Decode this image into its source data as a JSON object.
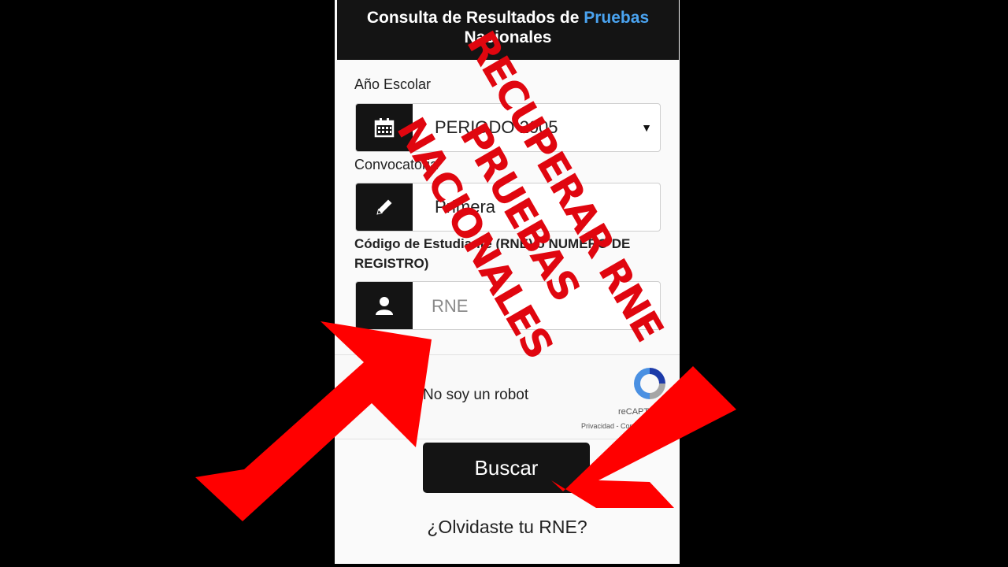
{
  "header": {
    "title_part1": "Consulta de Resultados de ",
    "title_accent": "Pruebas",
    "title_part2": "Nacionales"
  },
  "form": {
    "year": {
      "label": "Año Escolar",
      "value": "PERIODO 2005",
      "icon": "calendar-icon"
    },
    "convocatoria": {
      "label": "Convocatoria",
      "value": "Primera",
      "icon": "pencil-icon"
    },
    "student": {
      "label": "Código de Estudiante (RNE) o NUMERO DE REGISTRO)",
      "placeholder": "RNE",
      "icon": "user-icon"
    },
    "captcha": {
      "checkbox_label": "No soy un robot",
      "brand": "reCAPTCHA",
      "links": "Privacidad - Condiciones"
    },
    "search_button": "Buscar",
    "forgot_link": "¿Olvidaste tu RNE?"
  },
  "overlay": {
    "text_line1": "RECUPERAR RNE",
    "text_line2": "PRUEBAS",
    "text_line3": "NACIONALES",
    "color": "#e0060f"
  },
  "colors": {
    "background": "#000000",
    "header_bg": "#141414",
    "accent": "#4aa3f0",
    "button_bg": "#141414",
    "arrow": "#ff0000"
  }
}
